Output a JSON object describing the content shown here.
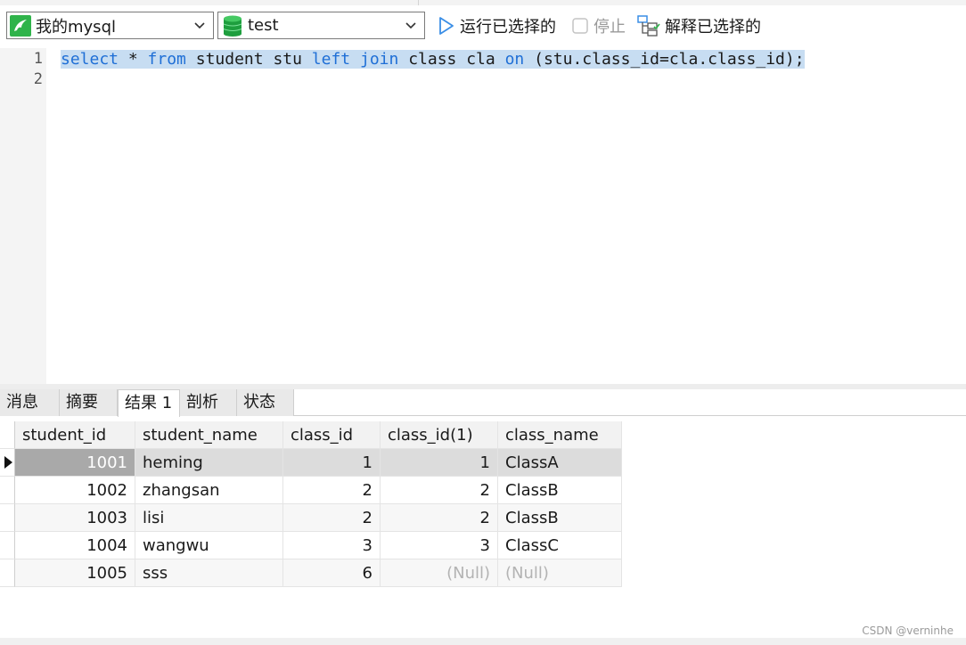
{
  "toolbar": {
    "connection": "我的mysql",
    "database": "test",
    "run_label": "运行已选择的",
    "stop_label": "停止",
    "explain_label": "解释已选择的"
  },
  "editor": {
    "line_numbers": [
      "1",
      "2"
    ],
    "code": {
      "t1": "select",
      "t2": " * ",
      "t3": "from",
      "t4": " student stu ",
      "t5": "left",
      "t6": " ",
      "t7": "join",
      "t8": " class cla ",
      "t9": "on",
      "t10": " (stu.class_id=cla.class_id);"
    }
  },
  "tabs": [
    "消息",
    "摘要",
    "结果 1",
    "剖析",
    "状态"
  ],
  "active_tab": "结果 1",
  "table": {
    "columns": [
      "student_id",
      "student_name",
      "class_id",
      "class_id(1)",
      "class_name"
    ],
    "rows": [
      [
        "1001",
        "heming",
        "1",
        "1",
        "ClassA"
      ],
      [
        "1002",
        "zhangsan",
        "2",
        "2",
        "ClassB"
      ],
      [
        "1003",
        "lisi",
        "2",
        "2",
        "ClassB"
      ],
      [
        "1004",
        "wangwu",
        "3",
        "3",
        "ClassC"
      ],
      [
        "1005",
        "sss",
        "6",
        "(Null)",
        "(Null)"
      ]
    ]
  },
  "watermark": "CSDN @verninhe",
  "colors": {
    "keyword": "#1f6fd6",
    "selection": "#c7ddf2",
    "conn_icon": "#2fb34a",
    "run_icon": "#3a8ee6"
  }
}
